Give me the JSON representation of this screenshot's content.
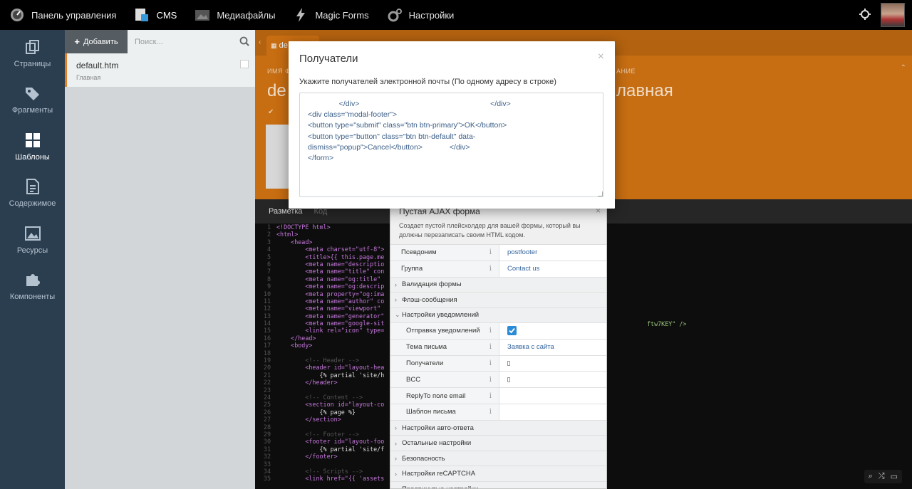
{
  "topbar": {
    "items": [
      {
        "label": "Панель управления",
        "icon": "dashboard-icon"
      },
      {
        "label": "CMS",
        "icon": "cms-icon"
      },
      {
        "label": "Медиафайлы",
        "icon": "media-icon"
      },
      {
        "label": "Magic Forms",
        "icon": "lightning-icon"
      },
      {
        "label": "Настройки",
        "icon": "gear-icon"
      }
    ]
  },
  "leftnav": {
    "items": [
      {
        "label": "Страницы",
        "icon": "pages-icon"
      },
      {
        "label": "Фрагменты",
        "icon": "tags-icon"
      },
      {
        "label": "Шаблоны",
        "icon": "layouts-icon"
      },
      {
        "label": "Содержимое",
        "icon": "content-icon"
      },
      {
        "label": "Ресурсы",
        "icon": "image-icon"
      },
      {
        "label": "Компоненты",
        "icon": "puzzle-icon"
      }
    ]
  },
  "filepanel": {
    "add_label": "Добавить",
    "search_placeholder": "Поиск...",
    "file": {
      "name": "default.htm",
      "sub": "Главная"
    }
  },
  "main": {
    "tab_label": "de",
    "name_label": "ИМЯ Ф",
    "desc_label": "АНИЕ",
    "big_left": "de",
    "big_right": "лавная",
    "editor_tabs": [
      "Разметка",
      "Код"
    ]
  },
  "code_lines": [
    "<!DOCTYPE html>",
    "<html>",
    "    <head>",
    "        <meta charset=\"utf-8\">",
    "        <title>{{ this.page.me",
    "        <meta name=\"descriptio",
    "        <meta name=\"title\" con",
    "        <meta name=\"og:title\" ",
    "        <meta name=\"og:descrip",
    "        <meta property=\"og:ima",
    "        <meta name=\"author\" co",
    "        <meta name=\"viewport\" ",
    "        <meta name=\"generator\"",
    "        <meta name=\"google-sit",
    "        <link rel=\"icon\" type=",
    "    </head>",
    "    <body>",
    "",
    "        <!-- Header -->",
    "        <header id=\"layout-hea",
    "            {% partial 'site/h",
    "        </header>",
    "",
    "        <!-- Content -->",
    "        <section id=\"layout-co",
    "            {% page %}",
    "        </section>",
    "",
    "        <!-- Footer -->",
    "        <footer id=\"layout-foo",
    "            {% partial 'site/f",
    "        </footer>",
    "",
    "        <!-- Scripts -->",
    "        <link href=\"{{ 'assets"
  ],
  "code_tail": "ftw7KEY\" />",
  "inspector": {
    "title": "Пустая AJAX форма",
    "description": "Создает пустой плейсхолдер для вашей формы, который вы должны перезаписать своим HTML кодом.",
    "rows": [
      {
        "kind": "prop",
        "name": "Псевдоним",
        "value": "postfooter"
      },
      {
        "kind": "prop",
        "name": "Группа",
        "value": "Contact us"
      },
      {
        "kind": "group",
        "name": "Валидация формы",
        "open": false
      },
      {
        "kind": "group",
        "name": "Флэш-сообщения",
        "open": false
      },
      {
        "kind": "group",
        "name": "Настройки уведомлений",
        "open": true
      },
      {
        "kind": "check",
        "name": "Отправка уведомлений",
        "value": "true"
      },
      {
        "kind": "sub",
        "name": "Тема письма",
        "value": "Заявка с сайта"
      },
      {
        "kind": "subbox",
        "name": "Получатели",
        "value": ""
      },
      {
        "kind": "subbox",
        "name": "BCC",
        "value": ""
      },
      {
        "kind": "sub",
        "name": "ReplyTo поле email",
        "value": ""
      },
      {
        "kind": "sub",
        "name": "Шаблон письма",
        "value": ""
      },
      {
        "kind": "group",
        "name": "Настройки авто-ответа",
        "open": false
      },
      {
        "kind": "group",
        "name": "Остальные настройки",
        "open": false
      },
      {
        "kind": "group",
        "name": "Безопасность",
        "open": false
      },
      {
        "kind": "group",
        "name": "Настройки reCAPTCHA",
        "open": false
      },
      {
        "kind": "group",
        "name": "Продвинутые настройки",
        "open": false
      }
    ]
  },
  "modal": {
    "title": "Получатели",
    "label": "Укажите получателей электронной почты (По одному адресу в строке)",
    "textarea_value": "               </div>                                                               </div>\n<div class=\"modal-footer\">\n<button type=\"submit\" class=\"btn btn-primary\">OK</button>\n<button type=\"button\" class=\"btn btn-default\" data-\ndismiss=\"popup\">Cancel</button>             </div>\n</form>"
  },
  "colors": {
    "accent": "#e67e22",
    "nav_bg": "#2b3e50",
    "topbar_bg": "#000000"
  }
}
